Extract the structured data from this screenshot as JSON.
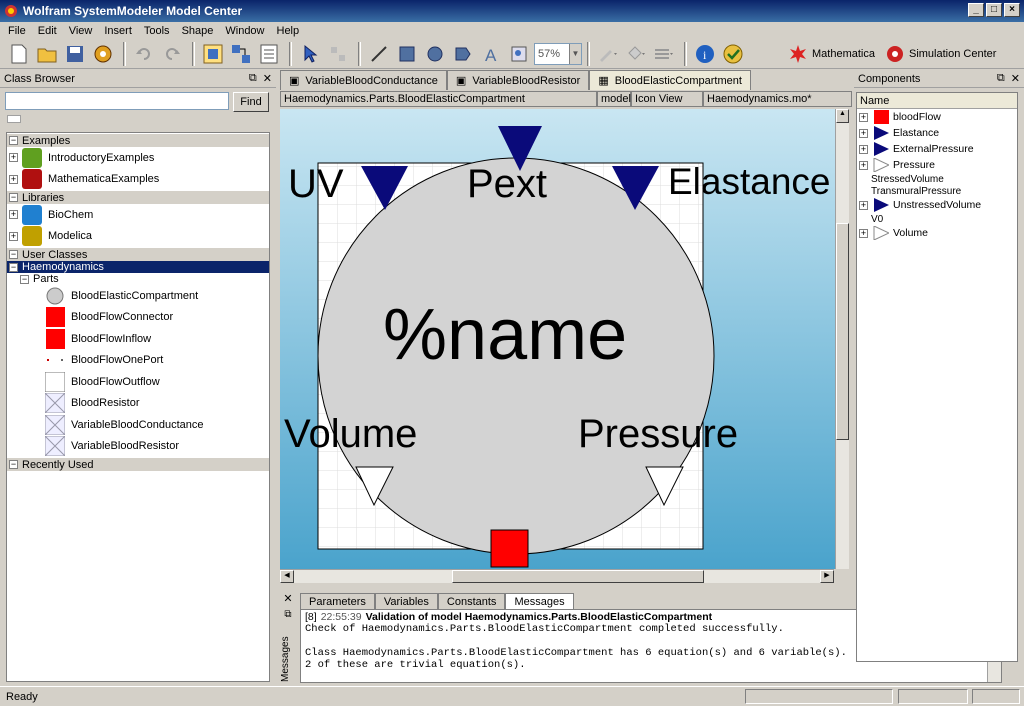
{
  "window": {
    "title": "Wolfram SystemModeler Model Center"
  },
  "menu": [
    "File",
    "Edit",
    "View",
    "Insert",
    "Tools",
    "Shape",
    "Window",
    "Help"
  ],
  "toolbar": {
    "zoom": "57%",
    "mathematica_label": "Mathematica",
    "simulation_label": "Simulation Center"
  },
  "class_browser": {
    "title": "Class Browser",
    "search_value": "",
    "find_label": "Find",
    "groups": {
      "examples": "Examples",
      "libraries": "Libraries",
      "user_classes": "User Classes",
      "recently_used": "Recently Used"
    },
    "examples": [
      "IntroductoryExamples",
      "MathematicaExamples"
    ],
    "libraries": [
      "BioChem",
      "Modelica"
    ],
    "selected": "Haemodynamics",
    "parts_label": "Parts",
    "parts": [
      "BloodElasticCompartment",
      "BloodFlowConnector",
      "BloodFlowInflow",
      "BloodFlowOnePort",
      "BloodFlowOutflow",
      "BloodResistor",
      "VariableBloodConductance",
      "VariableBloodResistor"
    ]
  },
  "tabs": [
    "VariableBloodConductance",
    "VariableBloodResistor",
    "BloodElasticCompartment"
  ],
  "pathbar": {
    "path": "Haemodynamics.Parts.BloodElasticCompartment",
    "kind": "model",
    "view": "Icon View",
    "file": "Haemodynamics.mo*"
  },
  "icon_labels": {
    "uv": "UV",
    "pext": "Pext",
    "elastance": "Elastance",
    "name": "%name",
    "volume": "Volume",
    "pressure": "Pressure"
  },
  "colors": {
    "port_blue": "#0a0a7a",
    "port_red": "#ff0000",
    "circle_fill": "#d3d3d3"
  },
  "components": {
    "title": "Components",
    "column": "Name",
    "items": [
      {
        "name": "bloodFlow",
        "kind": "red-square"
      },
      {
        "name": "Elastance",
        "kind": "blue-triangle"
      },
      {
        "name": "ExternalPressure",
        "kind": "blue-triangle"
      },
      {
        "name": "Pressure",
        "kind": "white-triangle"
      },
      {
        "name": "StressedVolume",
        "kind": "plain"
      },
      {
        "name": "TransmuralPressure",
        "kind": "plain"
      },
      {
        "name": "UnstressedVolume",
        "kind": "blue-triangle"
      },
      {
        "name": "V0",
        "kind": "plain"
      },
      {
        "name": "Volume",
        "kind": "white-triangle"
      }
    ]
  },
  "messages": {
    "tabs": [
      "Parameters",
      "Variables",
      "Constants",
      "Messages"
    ],
    "side_label": "Messages",
    "header_num": "[8]",
    "header_time": "22:55:39",
    "header_text": "Validation of model Haemodynamics.Parts.BloodElasticCompartment",
    "line1": "Check of Haemodynamics.Parts.BloodElasticCompartment completed successfully.",
    "line2": "Class Haemodynamics.Parts.BloodElasticCompartment has 6 equation(s) and 6 variable(s).",
    "line3": "2 of these are trivial equation(s)."
  },
  "status": "Ready"
}
